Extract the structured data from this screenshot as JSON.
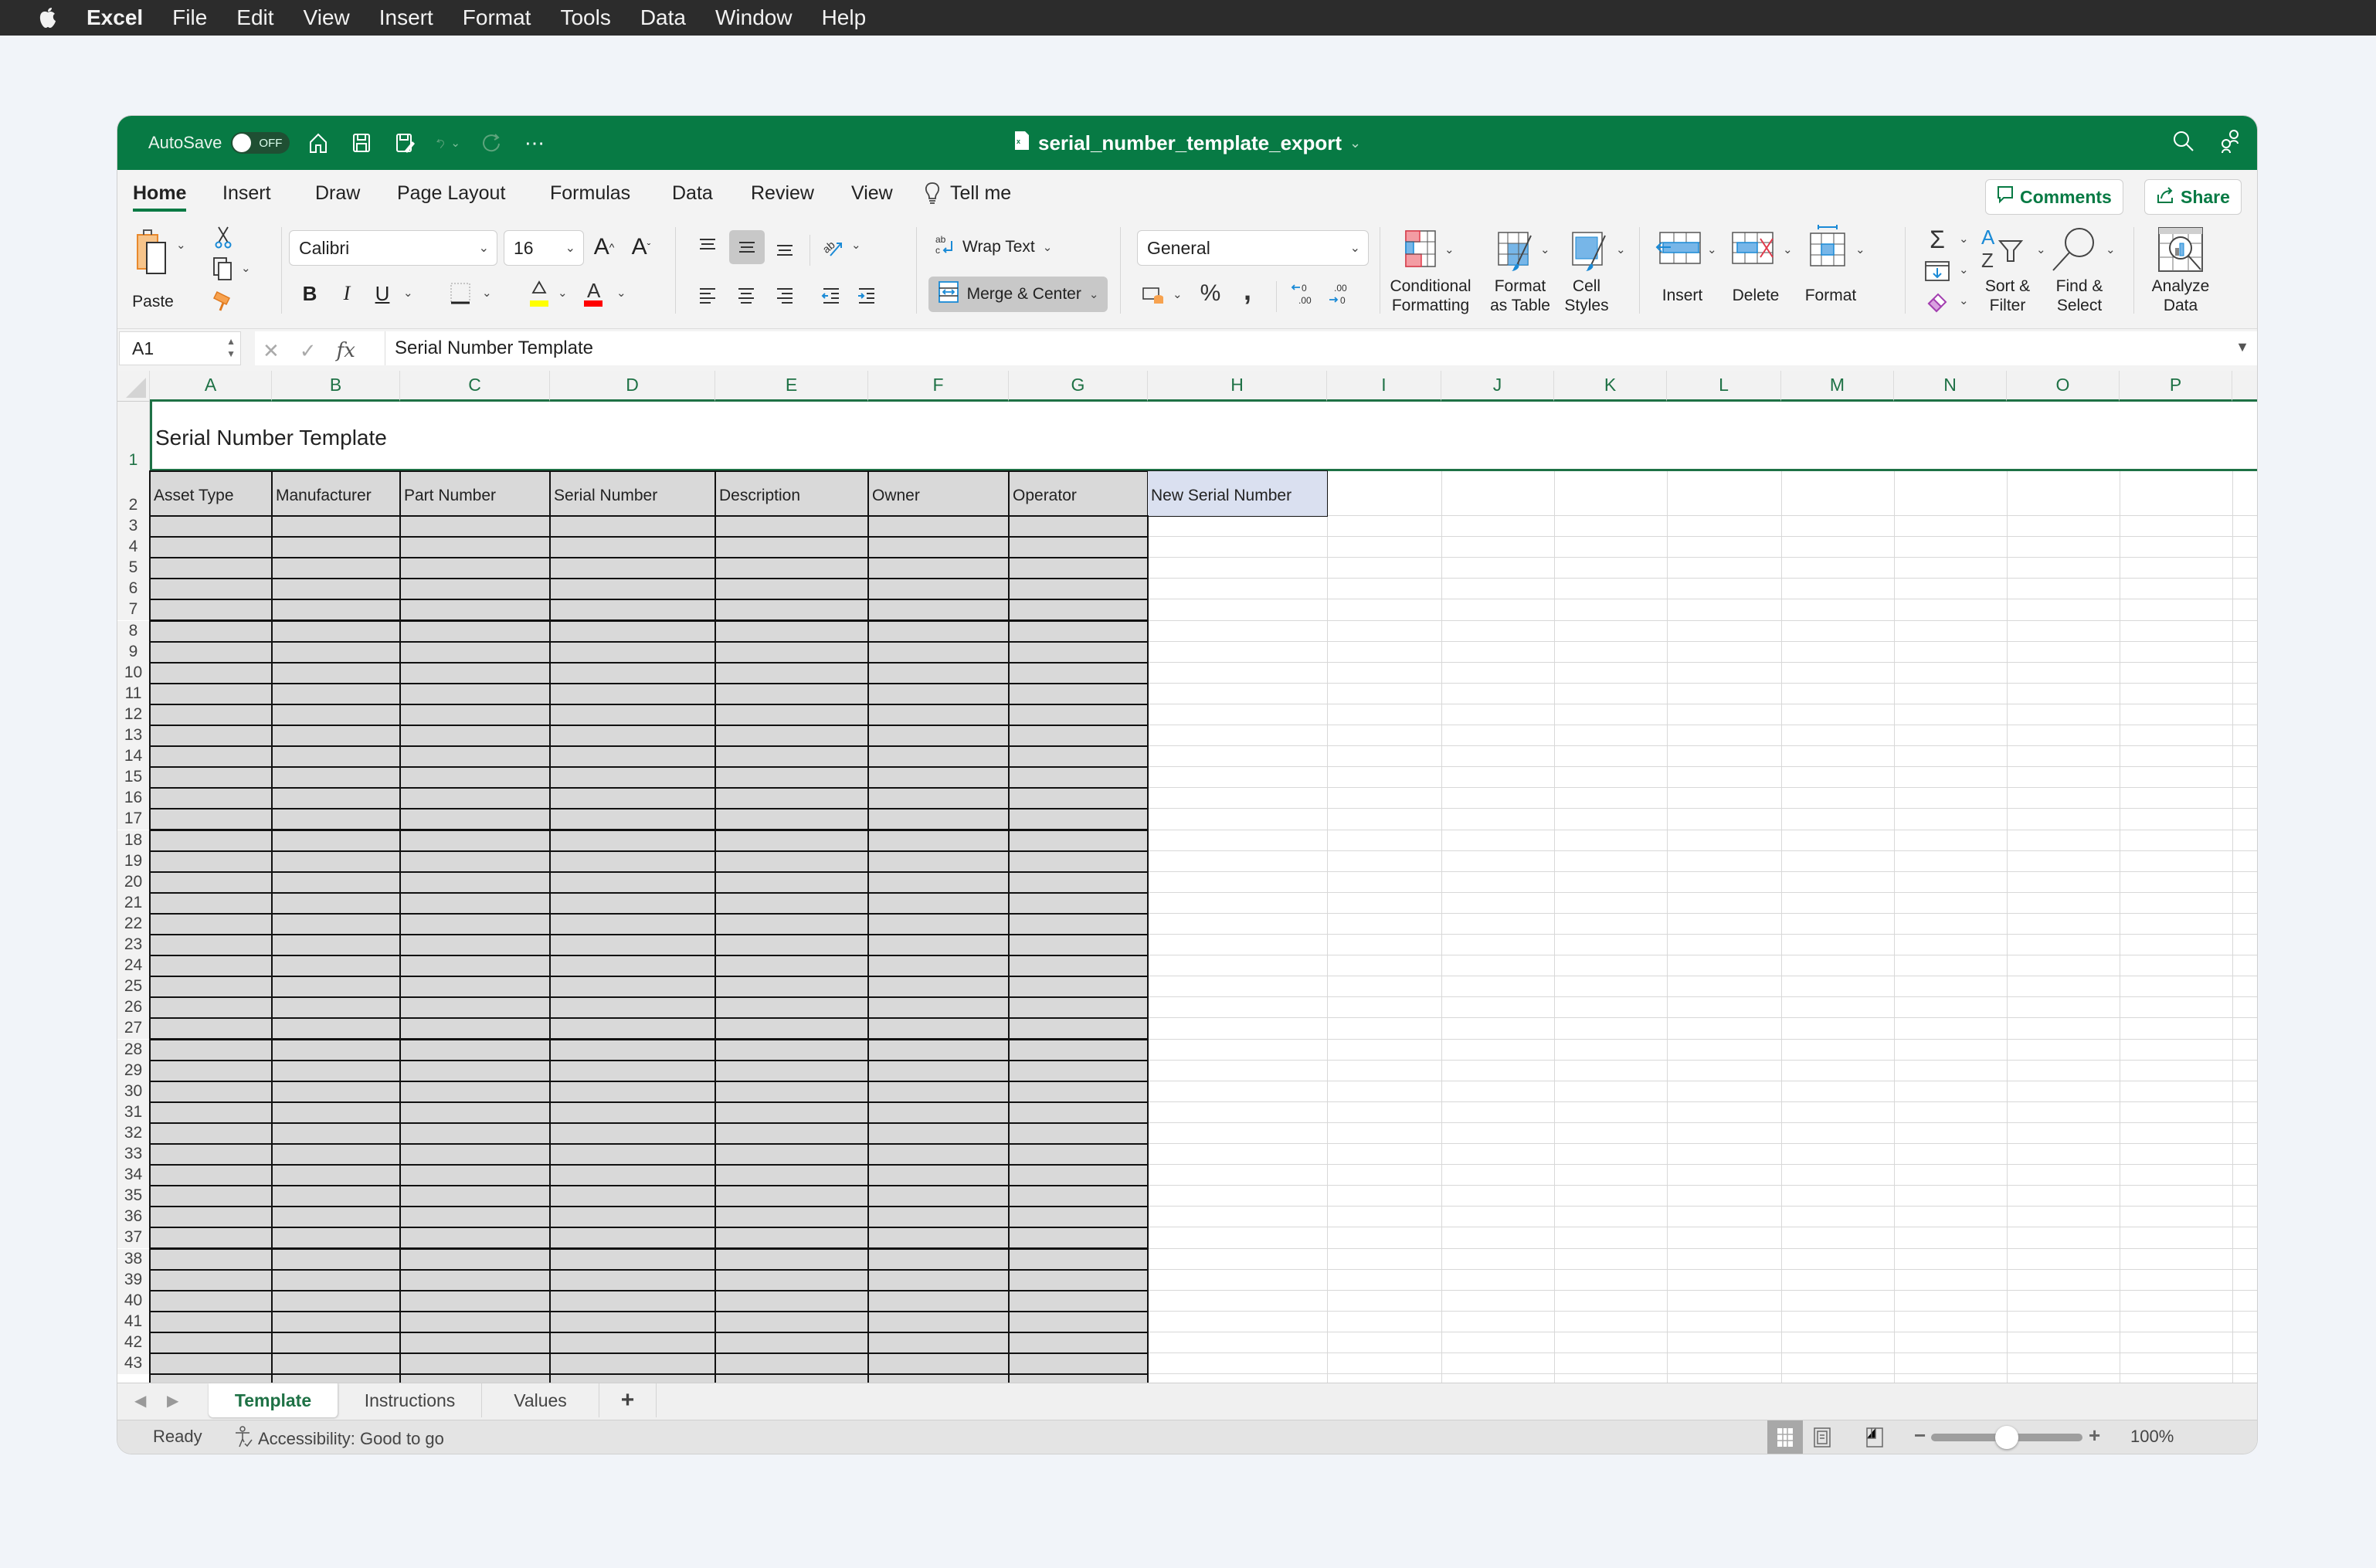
{
  "menubar": {
    "app": "Excel",
    "items": [
      "File",
      "Edit",
      "View",
      "Insert",
      "Format",
      "Tools",
      "Data",
      "Window",
      "Help"
    ]
  },
  "titlebar": {
    "autosave_label": "AutoSave",
    "autosave_state": "OFF",
    "document_title": "serial_number_template_export"
  },
  "ribbon_tabs": {
    "tabs": [
      "Home",
      "Insert",
      "Draw",
      "Page Layout",
      "Formulas",
      "Data",
      "Review",
      "View"
    ],
    "active": "Home",
    "tell_me": "Tell me",
    "comments": "Comments",
    "share": "Share"
  },
  "ribbon": {
    "paste": "Paste",
    "font_name": "Calibri",
    "font_size": "16",
    "bold": "B",
    "italic": "I",
    "underline": "U",
    "wrap_text": "Wrap Text",
    "merge_center": "Merge & Center",
    "number_format": "General",
    "percent": "%",
    "comma": ",",
    "conditional_formatting": [
      "Conditional",
      "Formatting"
    ],
    "format_as_table": [
      "Format",
      "as Table"
    ],
    "cell_styles": [
      "Cell",
      "Styles"
    ],
    "insert": "Insert",
    "delete": "Delete",
    "format": "Format",
    "sort_filter": [
      "Sort &",
      "Filter"
    ],
    "find_select": [
      "Find &",
      "Select"
    ],
    "analyze_data": [
      "Analyze",
      "Data"
    ],
    "colors": {
      "highlight": "#ffff00",
      "font_color": "#ff0000"
    }
  },
  "formula_bar": {
    "name_box": "A1",
    "content": "Serial Number Template"
  },
  "sheet": {
    "columns": [
      "A",
      "B",
      "C",
      "D",
      "E",
      "F",
      "G",
      "H",
      "I",
      "J",
      "K",
      "L",
      "M",
      "N",
      "O",
      "P"
    ],
    "title": "Serial Number Template",
    "headers": [
      "Asset Type",
      "Manufacturer",
      "Part Number",
      "Serial Number",
      "Description",
      "Owner",
      "Operator",
      "New Serial Number"
    ],
    "first_row": 1,
    "last_row_visible": 43,
    "colors": {
      "header_fill": "#d9d9d9",
      "new_header_fill": "#dae0f0",
      "accent": "#1e7145"
    }
  },
  "sheet_tabs": {
    "tabs": [
      "Template",
      "Instructions",
      "Values"
    ],
    "active": "Template",
    "add": "+"
  },
  "statusbar": {
    "ready": "Ready",
    "accessibility": "Accessibility: Good to go",
    "zoom": "100%",
    "zoom_fraction": 0.5
  }
}
